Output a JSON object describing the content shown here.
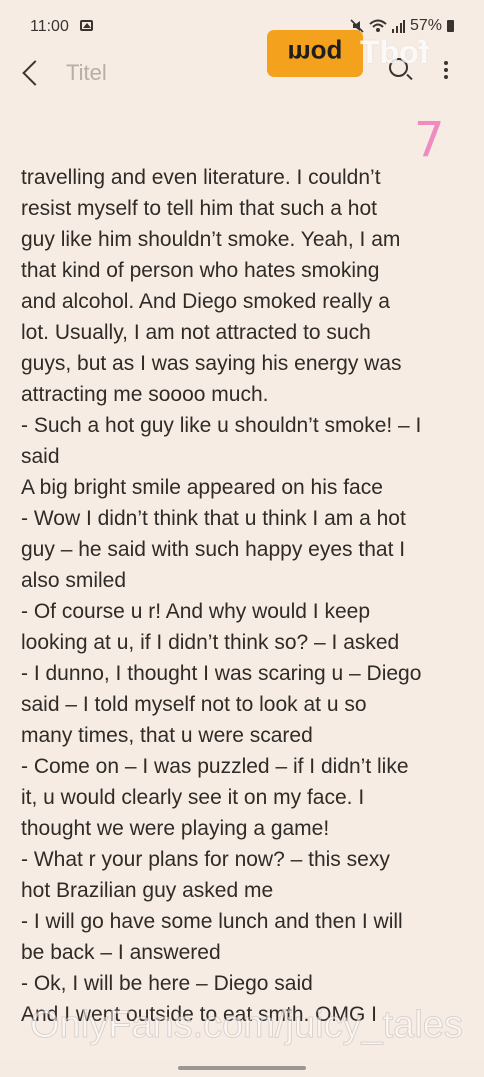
{
  "status_bar": {
    "time": "11:00",
    "battery": "57%"
  },
  "toolbar": {
    "title": "Titel"
  },
  "watermark": {
    "logo_text": "moq",
    "logo_tail": "fodT",
    "bottom": "OnlyFans.com/juicy_tales"
  },
  "note": {
    "page_number": "7",
    "lines": [
      "travelling and even literature. I couldn’t",
      "resist myself to tell him that such a hot",
      "guy like him shouldn’t smoke. Yeah, I am",
      "that kind of person who hates smoking",
      "and alcohol. And Diego smoked really a",
      "lot. Usually, I am not attracted to such",
      "guys, but as I was saying his energy was",
      "attracting me soooo much.",
      "- Such a hot guy like u shouldn’t smoke! – I",
      "said",
      "A big bright smile appeared on his face",
      "- Wow I didn’t think that u think I am a hot",
      "guy – he said with such happy eyes that I",
      "also smiled",
      "- Of course u r! And why would I keep",
      "looking at u, if I didn’t think so? – I asked",
      "- I dunno, I thought I was scaring u – Diego",
      "said – I told myself not to look at u so",
      "many times, that u were scared",
      "- Come on – I was puzzled – if I didn’t like",
      "it, u would clearly see it on my face. I",
      "thought we were playing a game!",
      "- What r your plans for now? – this sexy",
      "hot Brazilian guy asked me",
      "- I will go have some lunch and then I will",
      "be back – I answered",
      "- Ok, I will be here – Diego said",
      "And I went outside to eat smth. OMG I"
    ]
  }
}
